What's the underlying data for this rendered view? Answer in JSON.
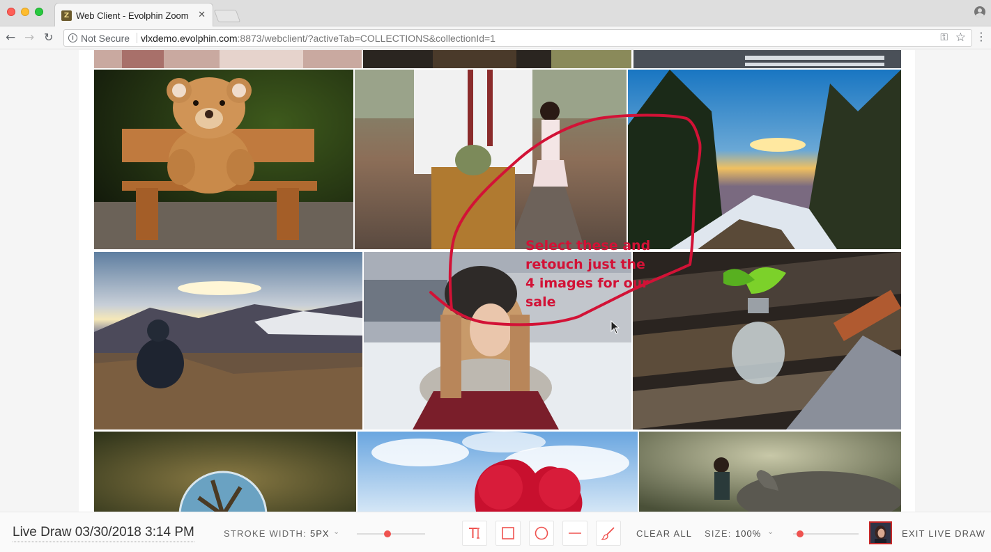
{
  "browser": {
    "tab_title": "Web Client - Evolphin Zoom",
    "favicon_letter": "Z",
    "close_glyph": "✕",
    "security_label": "Not Secure",
    "url_host": "vlxdemo.evolphin.com",
    "url_rest": ":8873/webclient/?activeTab=COLLECTIONS&collectionId=1"
  },
  "annotation": {
    "lines": [
      "Select these and",
      "retouch just the",
      "4 images for our",
      "sale"
    ],
    "color": "#d21236"
  },
  "drawbar": {
    "session_title": "Live Draw 03/30/2018 3:14 PM",
    "stroke_label": "STROKE WIDTH:",
    "stroke_value": "5PX",
    "clear_all": "CLEAR ALL",
    "size_label": "SIZE:",
    "size_value": "100%",
    "exit": "EXIT LIVE DRAW",
    "accent": "#ef5350",
    "tools": [
      "text-tool-icon",
      "rectangle-tool-icon",
      "circle-tool-icon",
      "line-tool-icon",
      "brush-tool-icon"
    ]
  }
}
